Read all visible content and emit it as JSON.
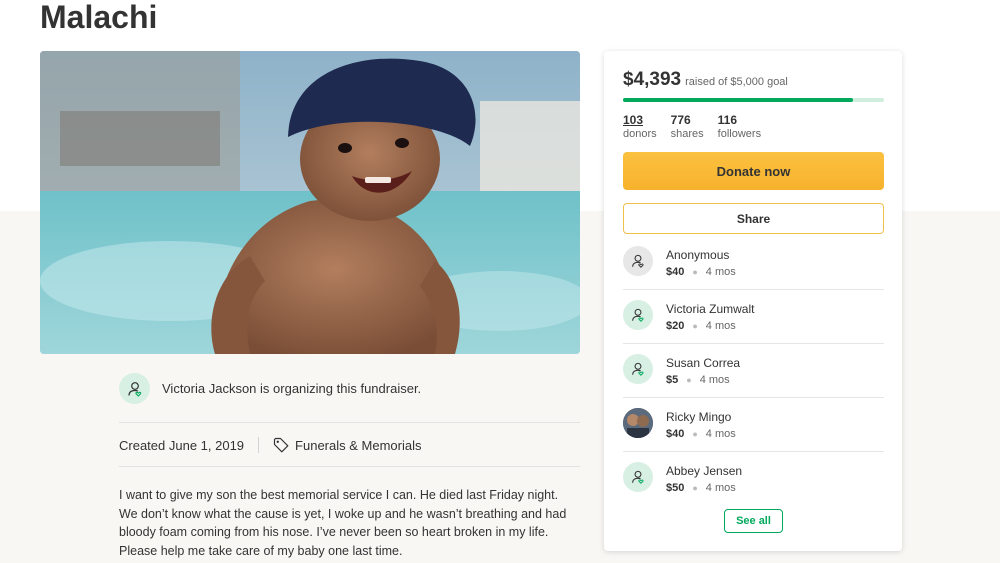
{
  "campaign": {
    "title": "Malachi",
    "organizer_text": "Victoria Jackson is organizing this fundraiser.",
    "created": "Created June 1, 2019",
    "category": "Funerals & Memorials",
    "story": [
      "I want to give my son the best memorial service I can. He died last Friday night. We don’t know what the cause is yet, I woke up and he wasn’t breathing and had bloody foam coming from his nose. I’ve never been so heart broken in my life.",
      "Please help me take care of my baby one last time."
    ]
  },
  "card": {
    "amount": "$4,393",
    "goal_text": "raised of $5,000 goal",
    "progress": 0.88,
    "stats": [
      {
        "value": "103",
        "label": "donors"
      },
      {
        "value": "776",
        "label": "shares"
      },
      {
        "value": "116",
        "label": "followers"
      }
    ],
    "donate_label": "Donate now",
    "share_label": "Share",
    "see_all_label": "See all",
    "donors": [
      {
        "name": "Anonymous",
        "amount": "$40",
        "time": "4 mos"
      },
      {
        "name": "Victoria Zumwalt",
        "amount": "$20",
        "time": "4 mos"
      },
      {
        "name": "Susan Correa",
        "amount": "$5",
        "time": "4 mos"
      },
      {
        "name": "Ricky Mingo",
        "amount": "$40",
        "time": "4 mos"
      },
      {
        "name": "Abbey Jensen",
        "amount": "$50",
        "time": "4 mos"
      }
    ]
  },
  "colors": {
    "brand_green": "#02a95c",
    "donate_yellow": "#f9b936",
    "progress_track": "#cfeedd"
  },
  "icons": {
    "organizer": "user-heart-icon",
    "category": "tag-icon",
    "donor": "user-heart-icon"
  }
}
